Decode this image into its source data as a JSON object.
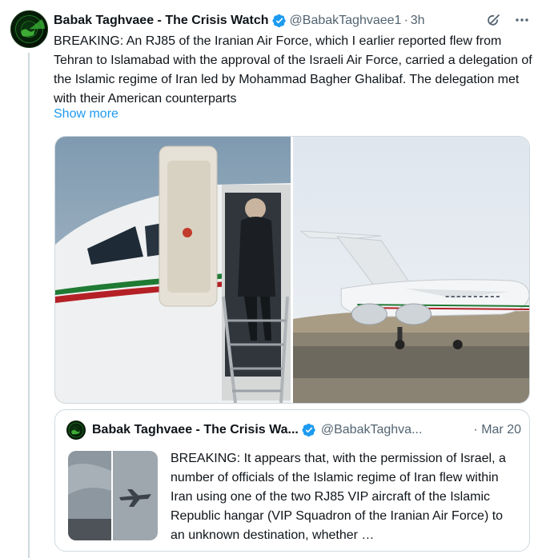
{
  "tweet": {
    "author_name": "Babak Taghvaee - The Crisis Watch",
    "handle": "@BabakTaghvaee1",
    "separator": "·",
    "time": "3h",
    "text": "BREAKING: An RJ85 of the Iranian Air Force, which I earlier reported flew from Tehran to Islamabad with the approval of the Israeli Air Force, carried a delegation of the Islamic regime of Iran led by Mohammad Bagher Ghalibaf. The delegation met with their American counterparts",
    "show_more_label": "Show more",
    "icons": {
      "verified": "verified-badge-icon",
      "grok": "grok-icon",
      "more": "more-options-icon"
    }
  },
  "quote": {
    "author_name": "Babak Taghvaee - The Crisis Wa...",
    "handle": "@BabakTaghva...",
    "time": "· Mar 20",
    "text": "BREAKING: It appears that, with the permission of Israel, a number of officials of the Islamic regime of Iran flew within Iran using one of the two RJ85 VIP aircraft of the Islamic Republic hangar (VIP Squadron of the Iranian Air Force) to an unknown destination, whether …"
  },
  "colors": {
    "link": "#1d9bf0",
    "verified": "#1d9bf0",
    "secondary_text": "#536471",
    "border": "#cfd9de"
  }
}
